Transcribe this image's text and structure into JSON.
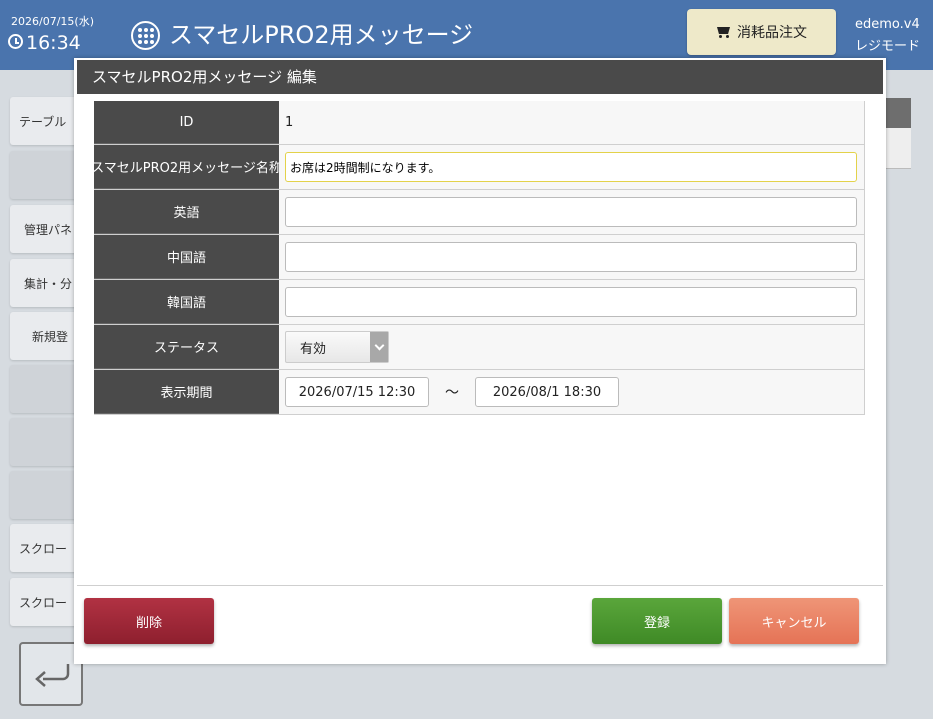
{
  "header": {
    "date": "2026/07/15(水)",
    "time": "16:34",
    "app_title": "スマセルPRO2用メッセージ",
    "supplies_button": "消耗品注文",
    "user": "edemo.v4",
    "mode": "レジモード"
  },
  "sidebar": {
    "items": [
      "テーブル",
      "",
      "管理パネ",
      "集計・分",
      "新規登",
      "",
      "",
      "",
      "スクロー",
      "スクロー"
    ]
  },
  "modal": {
    "title": "スマセルPRO2用メッセージ 編集",
    "fields": {
      "id_label": "ID",
      "id_value": "1",
      "name_label": "スマセルPRO2用メッセージ名称",
      "name_value": "お席は2時間制になります。",
      "english_label": "英語",
      "english_value": "",
      "chinese_label": "中国語",
      "chinese_value": "",
      "korean_label": "韓国語",
      "korean_value": "",
      "status_label": "ステータス",
      "status_value": "有効",
      "period_label": "表示期間",
      "period_start": "2026/07/15 12:30",
      "period_separator": "～",
      "period_end": "2026/08/1 18:30"
    },
    "buttons": {
      "delete": "削除",
      "register": "登録",
      "cancel": "キャンセル"
    }
  },
  "colors": {
    "header": "#4a74ad",
    "label_bg": "#4a4a4a",
    "delete": "#9e2636",
    "register": "#4b9830",
    "cancel": "#ea8366"
  }
}
